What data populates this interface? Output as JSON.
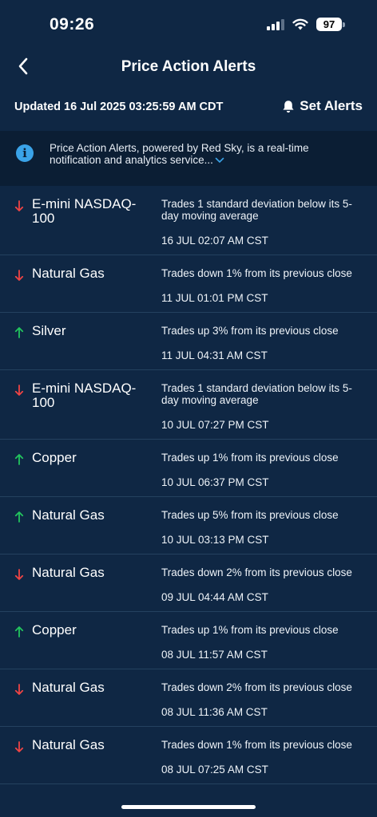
{
  "status_bar": {
    "time": "09:26",
    "battery": "97"
  },
  "header": {
    "title": "Price Action Alerts"
  },
  "updated": {
    "text": "Updated 16 Jul 2025 03:25:59 AM CDT",
    "set_alerts_label": "Set Alerts"
  },
  "info": {
    "text": "Price Action Alerts, powered by Red Sky, is a real-time notification and analytics service..."
  },
  "colors": {
    "up": "#22c55e",
    "down": "#ef4444",
    "info_icon": "#3aa3e8",
    "background": "#0f2744"
  },
  "alerts": [
    {
      "direction": "down",
      "instrument": "E-mini NASDAQ-100",
      "description": "Trades 1 standard deviation below its 5-day moving average",
      "timestamp": "16 JUL 02:07 AM CST"
    },
    {
      "direction": "down",
      "instrument": "Natural Gas",
      "description": "Trades down 1% from its previous close",
      "timestamp": "11 JUL 01:01 PM CST"
    },
    {
      "direction": "up",
      "instrument": "Silver",
      "description": "Trades up 3% from its previous close",
      "timestamp": "11 JUL 04:31 AM CST"
    },
    {
      "direction": "down",
      "instrument": "E-mini NASDAQ-100",
      "description": "Trades 1 standard deviation below its 5-day moving average",
      "timestamp": "10 JUL 07:27 PM CST"
    },
    {
      "direction": "up",
      "instrument": "Copper",
      "description": "Trades up 1% from its previous close",
      "timestamp": "10 JUL 06:37 PM CST"
    },
    {
      "direction": "up",
      "instrument": "Natural Gas",
      "description": "Trades up 5% from its previous close",
      "timestamp": "10 JUL 03:13 PM CST"
    },
    {
      "direction": "down",
      "instrument": "Natural Gas",
      "description": "Trades down 2% from its previous close",
      "timestamp": "09 JUL 04:44 AM CST"
    },
    {
      "direction": "up",
      "instrument": "Copper",
      "description": "Trades up 1% from its previous close",
      "timestamp": "08 JUL 11:57 AM CST"
    },
    {
      "direction": "down",
      "instrument": "Natural Gas",
      "description": "Trades down 2% from its previous close",
      "timestamp": "08 JUL 11:36 AM CST"
    },
    {
      "direction": "down",
      "instrument": "Natural Gas",
      "description": "Trades down 1% from its previous close",
      "timestamp": "08 JUL 07:25 AM CST"
    }
  ]
}
